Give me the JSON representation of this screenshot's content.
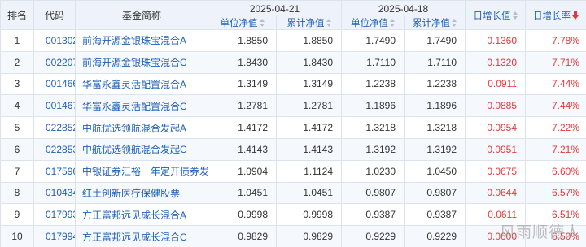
{
  "headers": {
    "rank": "排名",
    "code": "代码",
    "name": "基金简称",
    "date1": "2025-04-21",
    "date2": "2025-04-18",
    "unit_nav": "单位净值",
    "acc_nav": "累计净值",
    "daily_growth_value": "日增长值",
    "daily_growth_rate": "日增长率"
  },
  "rows": [
    {
      "rank": "1",
      "code": "001302",
      "name": "前海开源金银珠宝混合A",
      "unit1": "1.8850",
      "acc1": "1.8850",
      "unit2": "1.7490",
      "acc2": "1.7490",
      "growth_value": "0.1360",
      "growth_rate": "7.78%"
    },
    {
      "rank": "2",
      "code": "002207",
      "name": "前海开源金银珠宝混合C",
      "unit1": "1.8430",
      "acc1": "1.8430",
      "unit2": "1.7110",
      "acc2": "1.7110",
      "growth_value": "0.1320",
      "growth_rate": "7.71%"
    },
    {
      "rank": "3",
      "code": "001466",
      "name": "华富永鑫灵活配置混合A",
      "unit1": "1.3149",
      "acc1": "1.3149",
      "unit2": "1.2238",
      "acc2": "1.2238",
      "growth_value": "0.0911",
      "growth_rate": "7.44%"
    },
    {
      "rank": "4",
      "code": "001467",
      "name": "华富永鑫灵活配置混合C",
      "unit1": "1.2781",
      "acc1": "1.2781",
      "unit2": "1.1896",
      "acc2": "1.1896",
      "growth_value": "0.0885",
      "growth_rate": "7.44%"
    },
    {
      "rank": "5",
      "code": "022852",
      "name": "中航优选领航混合发起A",
      "unit1": "1.4172",
      "acc1": "1.4172",
      "unit2": "1.3218",
      "acc2": "1.3218",
      "growth_value": "0.0954",
      "growth_rate": "7.22%"
    },
    {
      "rank": "6",
      "code": "022853",
      "name": "中航优选领航混合发起C",
      "unit1": "1.4143",
      "acc1": "1.4143",
      "unit2": "1.3192",
      "acc2": "1.3192",
      "growth_value": "0.0951",
      "growth_rate": "7.21%"
    },
    {
      "rank": "7",
      "code": "017596",
      "name": "中银证券汇裕一年定开债券发起",
      "unit1": "1.0904",
      "acc1": "1.1124",
      "unit2": "1.0230",
      "acc2": "1.0450",
      "growth_value": "0.0675",
      "growth_rate": "6.60%"
    },
    {
      "rank": "8",
      "code": "010434",
      "name": "红土创新医疗保健股票",
      "unit1": "1.0451",
      "acc1": "1.0451",
      "unit2": "0.9807",
      "acc2": "0.9807",
      "growth_value": "0.0644",
      "growth_rate": "6.57%"
    },
    {
      "rank": "9",
      "code": "017993",
      "name": "方正富邦远见成长混合A",
      "unit1": "0.9998",
      "acc1": "0.9998",
      "unit2": "0.9387",
      "acc2": "0.9387",
      "growth_value": "0.0611",
      "growth_rate": "6.51%"
    },
    {
      "rank": "10",
      "code": "017994",
      "name": "方正富邦远见成长混合C",
      "unit1": "0.9829",
      "acc1": "0.9829",
      "unit2": "0.9229",
      "acc2": "0.9229",
      "growth_value": "0.0600",
      "growth_rate": "6.50%"
    }
  ],
  "watermark": "风雨顺德人",
  "colors": {
    "header_bg": "#eef3fb",
    "link": "#1f5fb7",
    "up": "#e4393c",
    "border": "#dde3ec"
  }
}
